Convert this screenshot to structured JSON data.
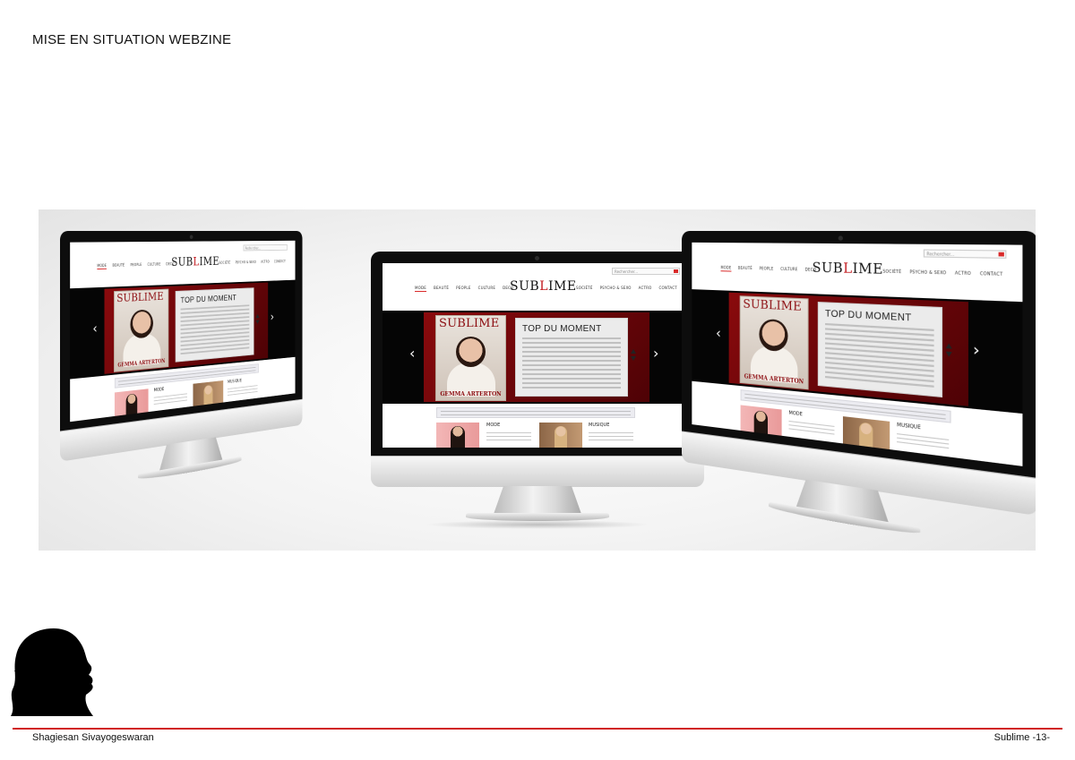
{
  "page": {
    "title": "MISE EN SITUATION WEBZINE"
  },
  "website": {
    "logo": {
      "text_before": "SUB",
      "mark": "L",
      "text_after": "IME"
    },
    "search": {
      "placeholder": "Rechercher..."
    },
    "nav_left": [
      "MODE",
      "BEAUTÉ",
      "PEOPLE",
      "CULTURE",
      "DECO"
    ],
    "nav_right": [
      "SOCIÉTÉ",
      "PSYCHO & SEXO",
      "ACTRO",
      "CONTACT"
    ],
    "hero": {
      "card_title": "TOP DU MOMENT",
      "prev": "‹",
      "next": "›"
    },
    "cover": {
      "title": "SUBLIME",
      "name": "GEMMA ARTERTON"
    },
    "sections": {
      "mode_label": "MODE",
      "music_label": "MUSIQUE"
    }
  },
  "footer": {
    "author": "Shagiesan Sivayogeswaran",
    "page_label": "Sublime -13-"
  },
  "colors": {
    "accent": "#d01f1f",
    "hero_red": "#8a0a0d"
  },
  "icons": {
    "silhouette": "woman-profile-silhouette-icon",
    "search": "search-icon"
  }
}
